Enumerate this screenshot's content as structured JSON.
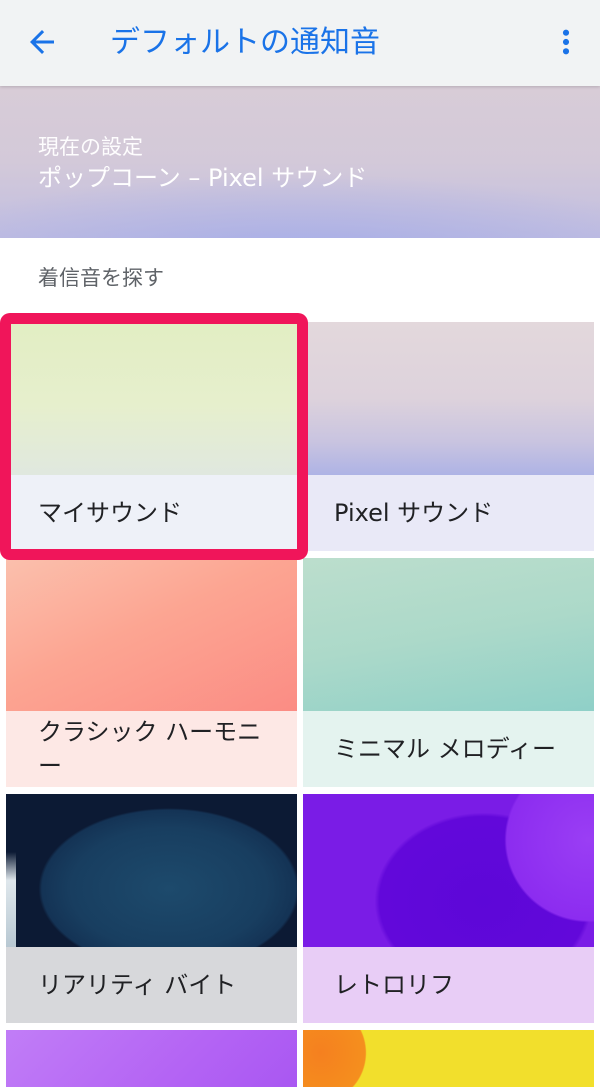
{
  "theme": {
    "accent": "#1a73e8",
    "highlight": "#f0155a"
  },
  "app_bar": {
    "title": "デフォルトの通知音",
    "back_icon": "arrow-back-icon",
    "menu_icon": "more-vert-icon"
  },
  "current_setting": {
    "label": "現在の設定",
    "value": "ポップコーン – Pixel サウンド"
  },
  "browse": {
    "heading": "着信音を探す",
    "categories": [
      {
        "label": "マイサウンド"
      },
      {
        "label": "Pixel サウンド"
      },
      {
        "label": "クラシック ハーモニー"
      },
      {
        "label": "ミニマル メロディー"
      },
      {
        "label": "リアリティ バイト"
      },
      {
        "label": "レトロリフ"
      }
    ]
  }
}
